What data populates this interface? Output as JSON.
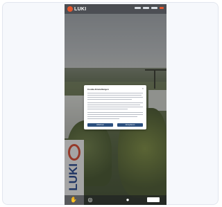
{
  "window": {
    "title": ""
  },
  "header": {
    "brand": "LUKI",
    "nav_items": [
      "menu-item",
      "menu-item",
      "menu-item",
      "menu-item"
    ]
  },
  "flag": {
    "text": "LUKI"
  },
  "cookie_dialog": {
    "title": "Cookie-Einstellungen",
    "close_glyph": "×",
    "reject_label": "Ablehnen",
    "accept_label": "Akzeptieren"
  },
  "toolbar": {
    "zoom_text": "",
    "icons": [
      "hand-icon",
      "compass-icon",
      "zoom-icon",
      "drop-icon",
      "logo-icon"
    ]
  },
  "colors": {
    "accent": "#e4572e",
    "button": "#2b4f7e",
    "card_bg": "#f6f8fc"
  }
}
